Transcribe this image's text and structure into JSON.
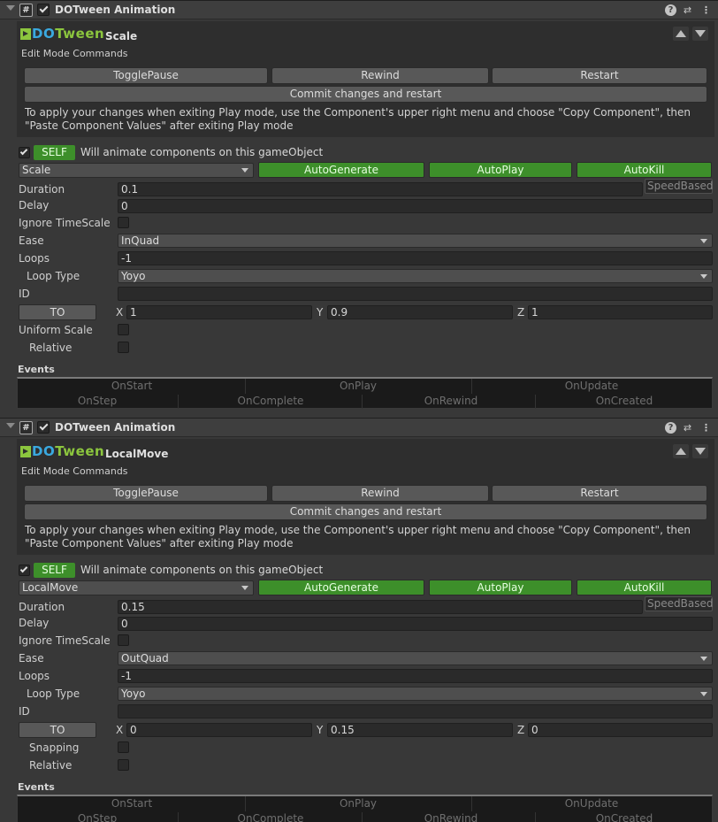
{
  "components": [
    {
      "header": {
        "title": "DOTween Animation",
        "script_glyph": "#"
      },
      "panel": {
        "logo_do": "DO",
        "logo_tween": "Tween",
        "animation_name": "Scale",
        "edit_mode_label": "Edit Mode Commands",
        "buttons": {
          "toggle_pause": "TogglePause",
          "rewind": "Rewind",
          "restart": "Restart",
          "commit": "Commit changes and restart"
        },
        "info": "To apply your changes when exiting Play mode, use the Component's upper right menu and choose \"Copy Component\", then \"Paste Component Values\" after exiting Play mode"
      },
      "self_badge": "SELF",
      "self_text": "Will animate components on this gameObject",
      "type_dropdown": "Scale",
      "auto_generate": "AutoGenerate",
      "auto_play": "AutoPlay",
      "auto_kill": "AutoKill",
      "fields": {
        "duration_label": "Duration",
        "duration": "0.1",
        "speed_based": "SpeedBased",
        "delay_label": "Delay",
        "delay": "0",
        "ignore_timescale_label": "Ignore TimeScale",
        "ease_label": "Ease",
        "ease": "InQuad",
        "loops_label": "Loops",
        "loops": "-1",
        "loop_type_label": "Loop Type",
        "loop_type": "Yoyo",
        "id_label": "ID",
        "id": "",
        "to_label": "TO",
        "x_label": "X",
        "x": "1",
        "y_label": "Y",
        "y": "0.9",
        "z_label": "Z",
        "z": "1",
        "opt1_label": "Uniform Scale",
        "opt2_label": "Relative"
      },
      "events_label": "Events",
      "events_row1": [
        "OnStart",
        "OnPlay",
        "OnUpdate"
      ],
      "events_row2": [
        "OnStep",
        "OnComplete",
        "OnRewind",
        "OnCreated"
      ]
    },
    {
      "header": {
        "title": "DOTween Animation",
        "script_glyph": "#"
      },
      "panel": {
        "logo_do": "DO",
        "logo_tween": "Tween",
        "animation_name": "LocalMove",
        "edit_mode_label": "Edit Mode Commands",
        "buttons": {
          "toggle_pause": "TogglePause",
          "rewind": "Rewind",
          "restart": "Restart",
          "commit": "Commit changes and restart"
        },
        "info": "To apply your changes when exiting Play mode, use the Component's upper right menu and choose \"Copy Component\", then \"Paste Component Values\" after exiting Play mode"
      },
      "self_badge": "SELF",
      "self_text": "Will animate components on this gameObject",
      "type_dropdown": "LocalMove",
      "auto_generate": "AutoGenerate",
      "auto_play": "AutoPlay",
      "auto_kill": "AutoKill",
      "fields": {
        "duration_label": "Duration",
        "duration": "0.15",
        "speed_based": "SpeedBased",
        "delay_label": "Delay",
        "delay": "0",
        "ignore_timescale_label": "Ignore TimeScale",
        "ease_label": "Ease",
        "ease": "OutQuad",
        "loops_label": "Loops",
        "loops": "-1",
        "loop_type_label": "Loop Type",
        "loop_type": "Yoyo",
        "id_label": "ID",
        "id": "",
        "to_label": "TO",
        "x_label": "X",
        "x": "0",
        "y_label": "Y",
        "y": "0.15",
        "z_label": "Z",
        "z": "0",
        "opt1_label": "Snapping",
        "opt2_label": "Relative"
      },
      "events_label": "Events",
      "events_row1": [
        "OnStart",
        "OnPlay",
        "OnUpdate"
      ],
      "events_row2": [
        "OnStep",
        "OnComplete",
        "OnRewind",
        "OnCreated"
      ]
    }
  ],
  "icons": {
    "help": "help-icon",
    "preset": "preset-icon",
    "menu": "context-menu-icon",
    "foldout": "foldout-arrow-icon"
  }
}
